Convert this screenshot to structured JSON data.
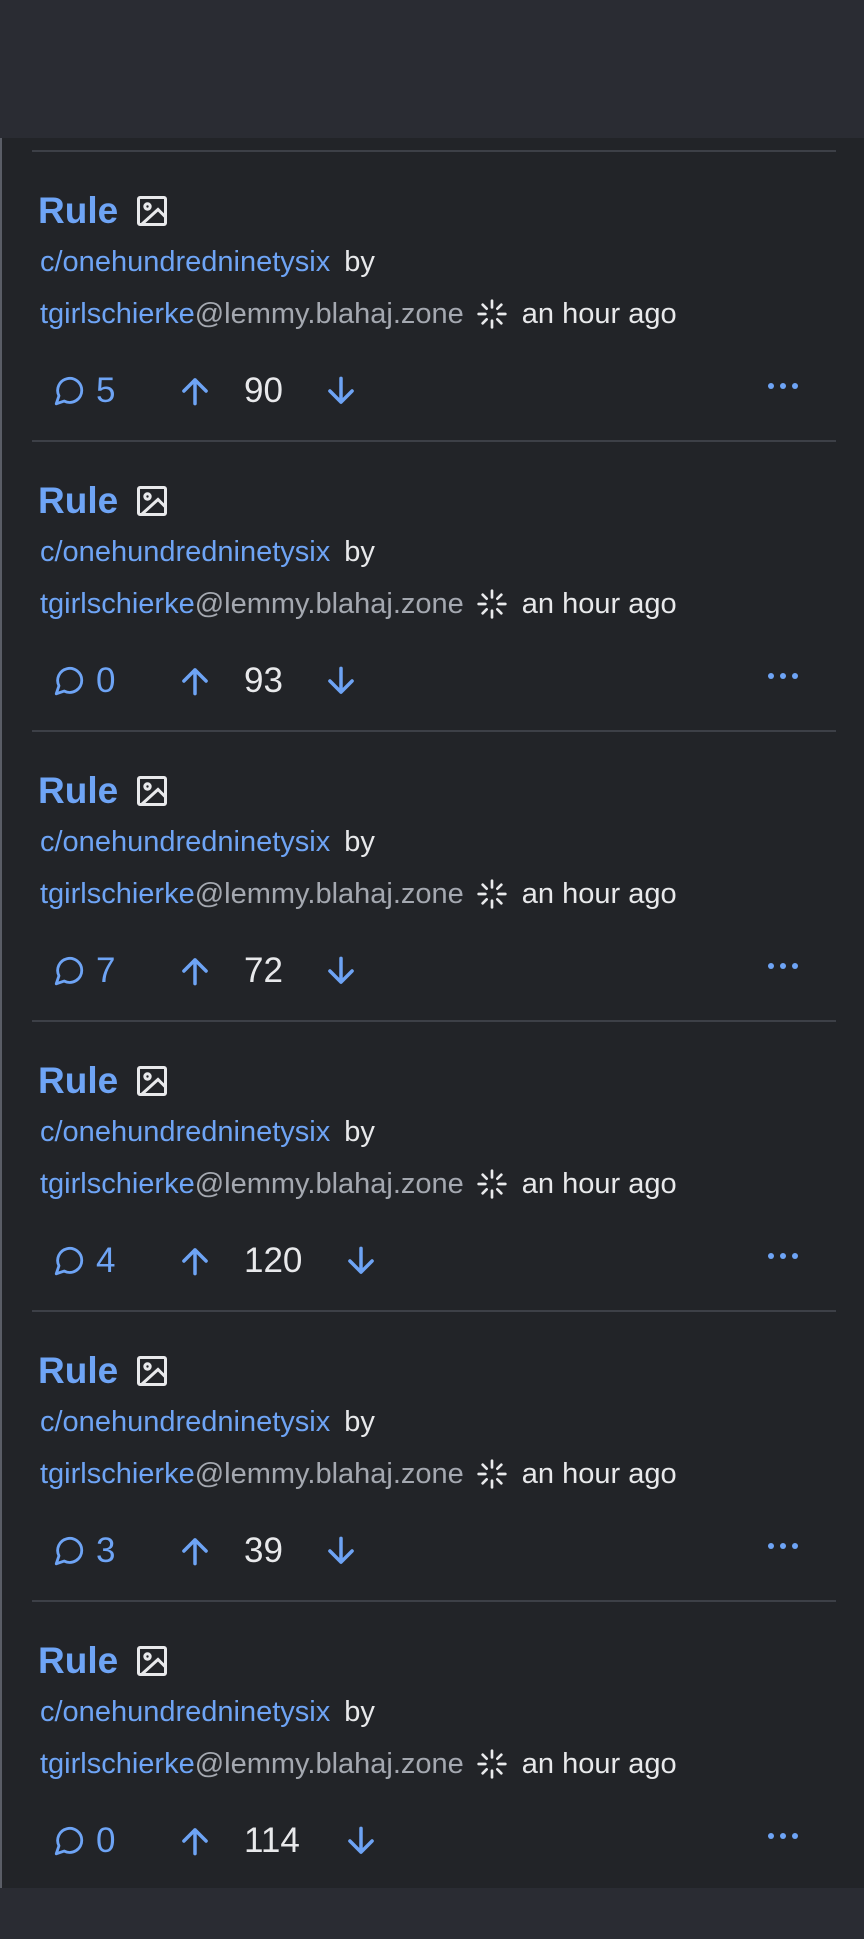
{
  "colors": {
    "accent": "#6ea4f5",
    "background": "#222428",
    "chrome": "#2a2c33",
    "text": "#e8e9eb",
    "muted": "#a4a8b0"
  },
  "posts": [
    {
      "title": "Rule",
      "community": "c/onehundredninetysix",
      "by": "by",
      "author": "tgirlschierke",
      "instance": "@lemmy.blahaj.zone",
      "time": "an hour ago",
      "comments": "5",
      "score": "90"
    },
    {
      "title": "Rule",
      "community": "c/onehundredninetysix",
      "by": "by",
      "author": "tgirlschierke",
      "instance": "@lemmy.blahaj.zone",
      "time": "an hour ago",
      "comments": "0",
      "score": "93"
    },
    {
      "title": "Rule",
      "community": "c/onehundredninetysix",
      "by": "by",
      "author": "tgirlschierke",
      "instance": "@lemmy.blahaj.zone",
      "time": "an hour ago",
      "comments": "7",
      "score": "72"
    },
    {
      "title": "Rule",
      "community": "c/onehundredninetysix",
      "by": "by",
      "author": "tgirlschierke",
      "instance": "@lemmy.blahaj.zone",
      "time": "an hour ago",
      "comments": "4",
      "score": "120"
    },
    {
      "title": "Rule",
      "community": "c/onehundredninetysix",
      "by": "by",
      "author": "tgirlschierke",
      "instance": "@lemmy.blahaj.zone",
      "time": "an hour ago",
      "comments": "3",
      "score": "39"
    },
    {
      "title": "Rule",
      "community": "c/onehundredninetysix",
      "by": "by",
      "author": "tgirlschierke",
      "instance": "@lemmy.blahaj.zone",
      "time": "an hour ago",
      "comments": "0",
      "score": "114"
    }
  ],
  "icons": {
    "post_type": "image-icon",
    "new_account": "sparkle-icon",
    "comments": "comment-icon",
    "upvote": "arrow-up-icon",
    "downvote": "arrow-down-icon",
    "more": "more-options-icon"
  }
}
